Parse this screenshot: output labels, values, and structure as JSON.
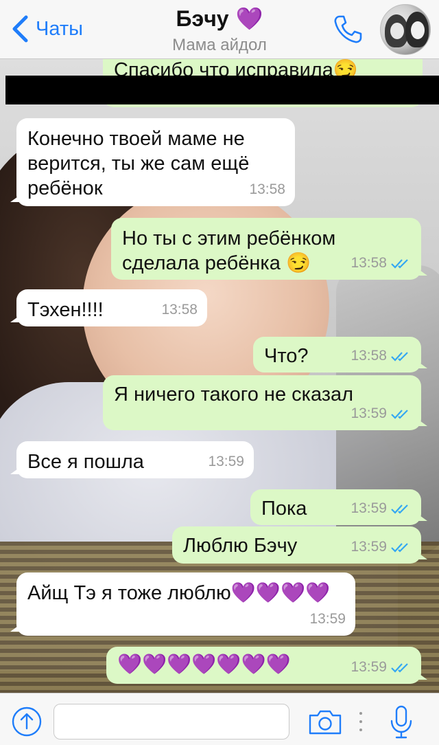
{
  "header": {
    "back_label": "Чаты",
    "title": "Бэчу",
    "title_emoji": "💜",
    "subtitle": "Мама айдол"
  },
  "messages": [
    {
      "direction": "out",
      "text": "Спасибо что исправила😏",
      "time": ""
    },
    {
      "direction": "in",
      "text": "Конечно твоей маме не верится, ты же сам ещё ребёнок",
      "time": "13:58"
    },
    {
      "direction": "out",
      "text": "Но ты с этим ребёнком сделала ребёнка 😏",
      "time": "13:58"
    },
    {
      "direction": "in",
      "text": "Тэхен!!!!",
      "time": "13:58"
    },
    {
      "direction": "out",
      "text": "Что?",
      "time": "13:58"
    },
    {
      "direction": "out",
      "text": "Я ничего такого не сказал",
      "time": "13:59"
    },
    {
      "direction": "in",
      "text": "Все я пошла",
      "time": "13:59"
    },
    {
      "direction": "out",
      "text": "Пока",
      "time": "13:59"
    },
    {
      "direction": "out",
      "text": "Люблю Бэчу",
      "time": "13:59"
    },
    {
      "direction": "in",
      "text": "Айщ Тэ я тоже люблю💜💜💜💜",
      "time": "13:59"
    },
    {
      "direction": "out",
      "text": "💜💜💜💜💜💜💜",
      "time": "13:59"
    }
  ],
  "input": {
    "placeholder": ""
  },
  "icons": {
    "back": "chevron-left-icon",
    "call": "phone-icon",
    "attach": "upload-icon",
    "camera": "camera-icon",
    "mic": "microphone-icon"
  },
  "colors": {
    "accent": "#1f7dfa",
    "outgoing_bubble": "#dcf8c6",
    "incoming_bubble": "#ffffff",
    "read_ticks": "#34a7f2",
    "redaction": "#000000"
  }
}
